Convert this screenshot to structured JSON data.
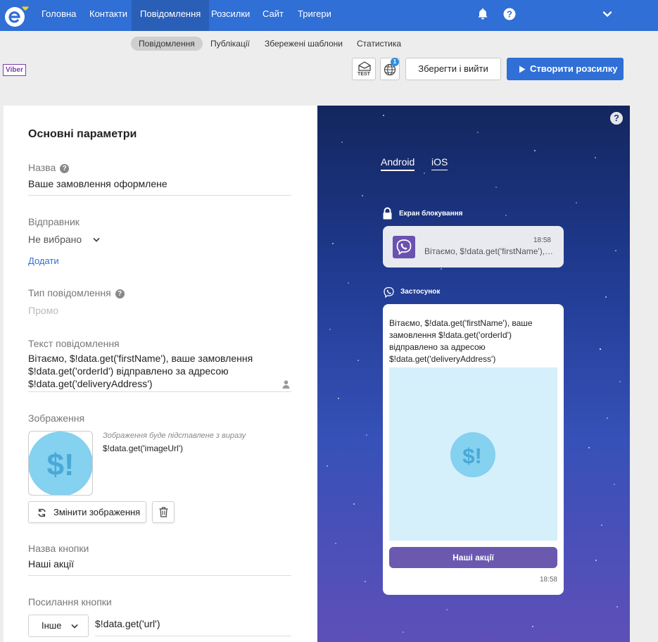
{
  "nav": {
    "items": [
      "Головна",
      "Контакти",
      "Повідомлення",
      "Розсилки",
      "Сайт",
      "Тригери"
    ],
    "active": "Повідомлення",
    "icons": [
      "bell-icon",
      "help-icon",
      "chevron-down-icon"
    ]
  },
  "subnav": {
    "items": [
      "Повідомлення",
      "Публікації",
      "Збережені шаблони",
      "Статистика"
    ],
    "active": "Повідомлення"
  },
  "toolbar": {
    "channel_tag": "Viber",
    "test_label": "TEST",
    "badge_count": "1",
    "save_label": "Зберегти і вийти",
    "create_label": "Створити розсилку"
  },
  "form": {
    "title": "Основні параметри",
    "name_label": "Назва",
    "name_value": "Ваше замовлення оформлене",
    "sender_label": "Відправник",
    "sender_value": "Не вибрано",
    "add_link": "Додати",
    "type_label": "Тип повідомлення",
    "type_value": "Промо",
    "text_label": "Текст повідомлення",
    "text_value": "Вітаємо, $!data.get('firstName'), ваше замовлення $!data.get('orderId') відправлено за адресою $!data.get('deliveryAddress')",
    "image_label": "Зображення",
    "image_hint": "Зображення буде підставлене з виразу",
    "image_expr": "$!data.get('imageUrl')",
    "change_image": "Змінити зображення",
    "button_name_label": "Назва кнопки",
    "button_name_value": "Наші акції",
    "button_link_label": "Посилання кнопки",
    "button_link_type": "Інше",
    "button_link_value": "$!data.get('url')"
  },
  "preview": {
    "tabs": [
      "Android",
      "iOS"
    ],
    "active_tab": "Android",
    "lock_label": "Екран блокування",
    "lock_time": "18:58",
    "lock_text": "Вітаємо, $!data.get('firstName'), ваше замовлення $!data.get('orderId')",
    "app_label": "Застосунок",
    "app_text": "Вітаємо, $!data.get('firstName'), ваше замовлення $!data.get('orderId') відправлено за адресою $!data.get('deliveryAddress')",
    "app_button": "Наші акції",
    "app_time": "18:58"
  },
  "placeholder_glyph": "$!",
  "colors": {
    "nav_bg": "#2f6fd6",
    "primary": "#2f6fd6",
    "viber_purple": "#6b59b0",
    "image_placeholder": "#84d1f0"
  }
}
